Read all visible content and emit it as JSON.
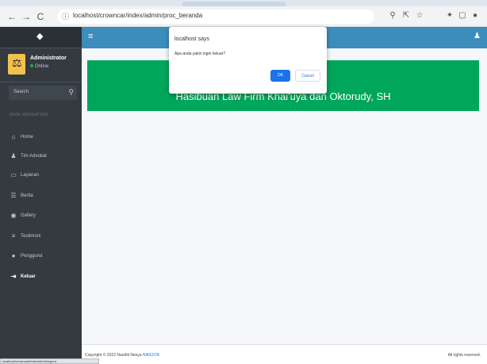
{
  "browser": {
    "url": "localhost/crowncar/index/admin/proc_beranda",
    "nav": {
      "back": "←",
      "forward": "→",
      "reload": "C"
    }
  },
  "sidebar": {
    "user": {
      "name": "Administrator",
      "status": "Online"
    },
    "search": {
      "placeholder": "Search"
    },
    "nav_header": "MAIN NAVIGATION",
    "items": [
      {
        "label": "Home",
        "icon": "home-icon",
        "glyph": "⌂"
      },
      {
        "label": "Tim Advokat",
        "icon": "person-icon",
        "glyph": "♟"
      },
      {
        "label": "Layanan",
        "icon": "monitor-icon",
        "glyph": "▭"
      },
      {
        "label": "Berita",
        "icon": "news-icon",
        "glyph": "☰"
      },
      {
        "label": "Gallery",
        "icon": "camera-icon",
        "glyph": "◉"
      },
      {
        "label": "Testimoni",
        "icon": "list-icon",
        "glyph": "≡"
      },
      {
        "label": "Pengguna",
        "icon": "user-icon",
        "glyph": "●"
      },
      {
        "label": "Keluar",
        "icon": "logout-icon",
        "glyph": "⇥"
      }
    ]
  },
  "main": {
    "welcome": "Hasibuan Law Firm Khai'uya dan Oktorudy, SH"
  },
  "footer": {
    "copyright_prefix": "Copyright © 2022 Nanditi Nesya ",
    "copyright_link": "NIKESTA",
    "rights": "All rights reserved."
  },
  "dialog": {
    "title": "localhost says",
    "message": "Apa anda yakin ingin keluar?",
    "ok_label": "OK",
    "cancel_label": "Cancel"
  },
  "status_bar": {
    "text": "localhost/crowncar/index/admin/logout"
  },
  "colors": {
    "sidebar_bg": "#343a40",
    "topbar_bg": "#3c8dbc",
    "welcome_bg": "#00a65a",
    "dialog_ok": "#1a73e8"
  }
}
